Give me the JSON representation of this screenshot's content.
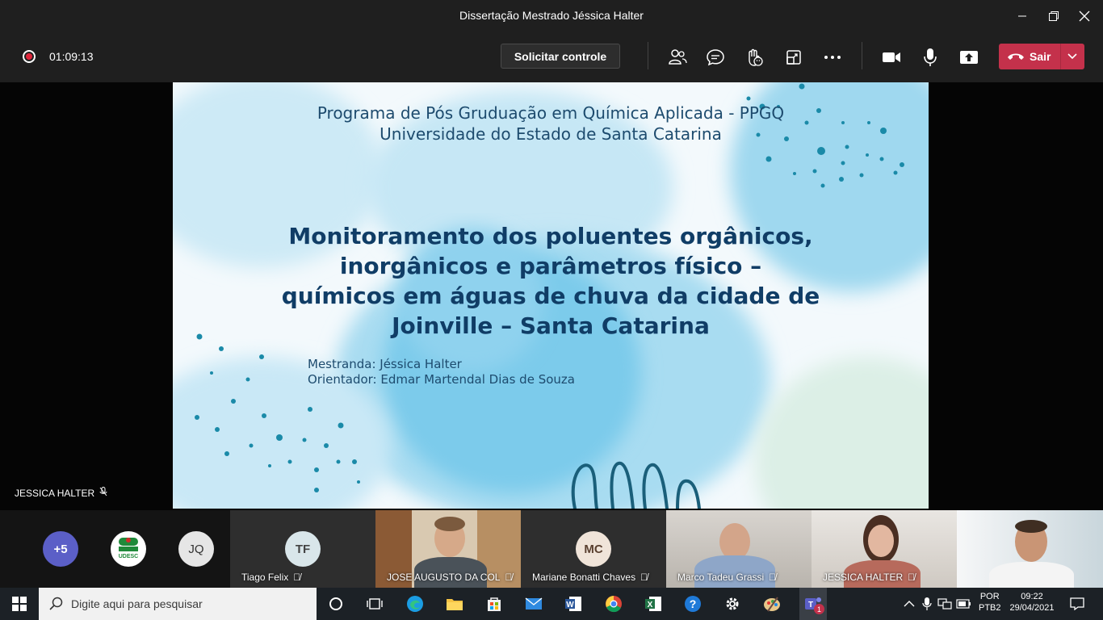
{
  "window": {
    "title": "Dissertação Mestrado Jéssica Halter"
  },
  "meeting": {
    "timer": "01:09:13",
    "request_control_label": "Solicitar controle",
    "leave_label": "Sair"
  },
  "slide": {
    "program_line1": "Programa de Pós Gruduação em Química Aplicada - PPGQ",
    "program_line2": "Universidade do Estado de Santa Catarina",
    "title_line1": "Monitoramento dos poluentes orgânicos,",
    "title_line2": "inorgânicos e parâmetros físico –",
    "title_line3": "químicos em águas de chuva da cidade de",
    "title_line4": "Joinville – Santa Catarina",
    "student": "Mestranda: Jéssica Halter",
    "advisor": "Orientador: Edmar Martendal Dias de Souza"
  },
  "presenter": {
    "name": "JESSICA HALTER"
  },
  "participants": {
    "more_count": "+5",
    "logo_text": "UDESC",
    "jq_initials": "JQ",
    "tiago_initials": "TF",
    "tiago_name": "Tiago Felix",
    "jose_name": "JOSE AUGUSTO DA COL",
    "mariane_initials": "MC",
    "mariane_name": "Mariane Bonatti Chaves",
    "marco_name": "Marco Tadeu Grassi",
    "jessica_name": "JESSICA HALTER"
  },
  "taskbar": {
    "search_placeholder": "Digite aqui para pesquisar",
    "lang_line1": "POR",
    "lang_line2": "PTB2",
    "time": "09:22",
    "date": "29/04/2021",
    "teams_badge": "1"
  },
  "colors": {
    "leave_red": "#c4314b",
    "record_red": "#e0263b",
    "slide_title": "#103d66",
    "blob_blue": "#6cc3e8"
  }
}
